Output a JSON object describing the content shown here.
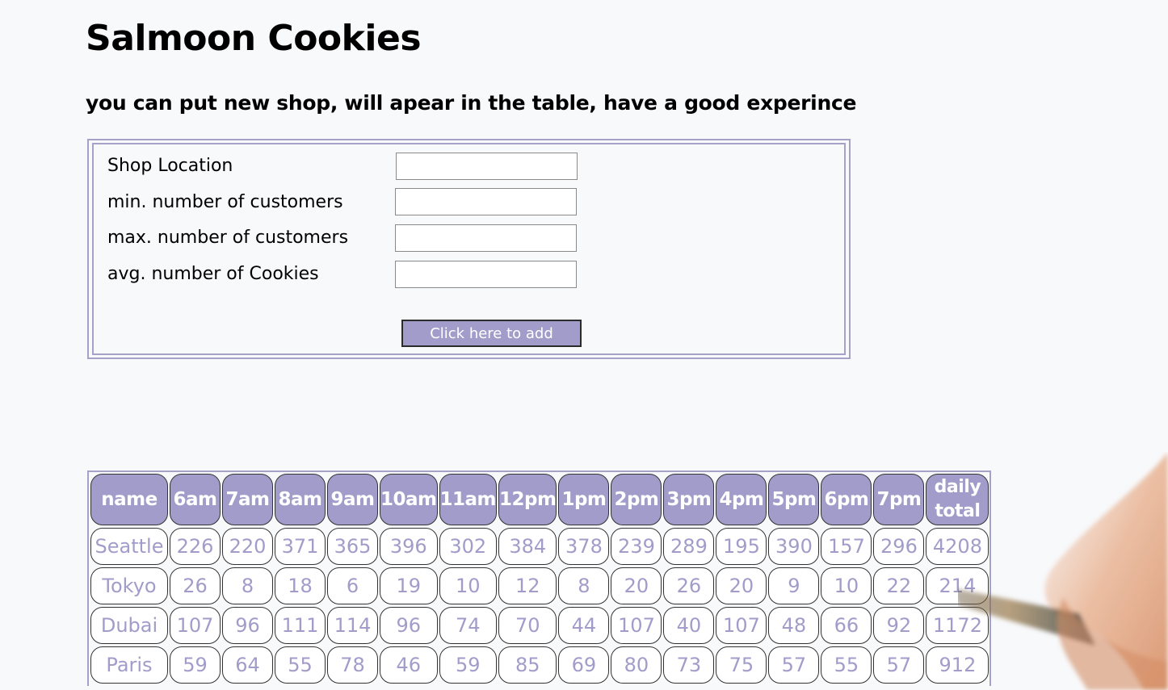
{
  "header": {
    "title": "Salmoon Cookies",
    "subtitle": "you can put new shop, will apear in the table, have a good experince"
  },
  "form": {
    "fields": [
      {
        "label": "Shop Location",
        "value": ""
      },
      {
        "label": "min. number of customers",
        "value": ""
      },
      {
        "label": "max. number of customers",
        "value": ""
      },
      {
        "label": "avg. number of Cookies",
        "value": ""
      }
    ],
    "submit_label": "Click here to add"
  },
  "table": {
    "headers": [
      "name",
      "6am",
      "7am",
      "8am",
      "9am",
      "10am",
      "11am",
      "12pm",
      "1pm",
      "2pm",
      "3pm",
      "4pm",
      "5pm",
      "6pm",
      "7pm",
      "daily total"
    ],
    "rows": [
      [
        "Seattle",
        "226",
        "220",
        "371",
        "365",
        "396",
        "302",
        "384",
        "378",
        "239",
        "289",
        "195",
        "390",
        "157",
        "296",
        "4208"
      ],
      [
        "Tokyo",
        "26",
        "8",
        "18",
        "6",
        "19",
        "10",
        "12",
        "8",
        "20",
        "26",
        "20",
        "9",
        "10",
        "22",
        "214"
      ],
      [
        "Dubai",
        "107",
        "96",
        "111",
        "114",
        "96",
        "74",
        "70",
        "44",
        "107",
        "40",
        "107",
        "48",
        "66",
        "92",
        "1172"
      ],
      [
        "Paris",
        "59",
        "64",
        "55",
        "78",
        "46",
        "59",
        "85",
        "69",
        "80",
        "73",
        "75",
        "57",
        "55",
        "57",
        "912"
      ]
    ]
  },
  "colors": {
    "accent": "#a19cc9",
    "background": "#f8f9fb",
    "cell_text": "#a19cc9"
  }
}
